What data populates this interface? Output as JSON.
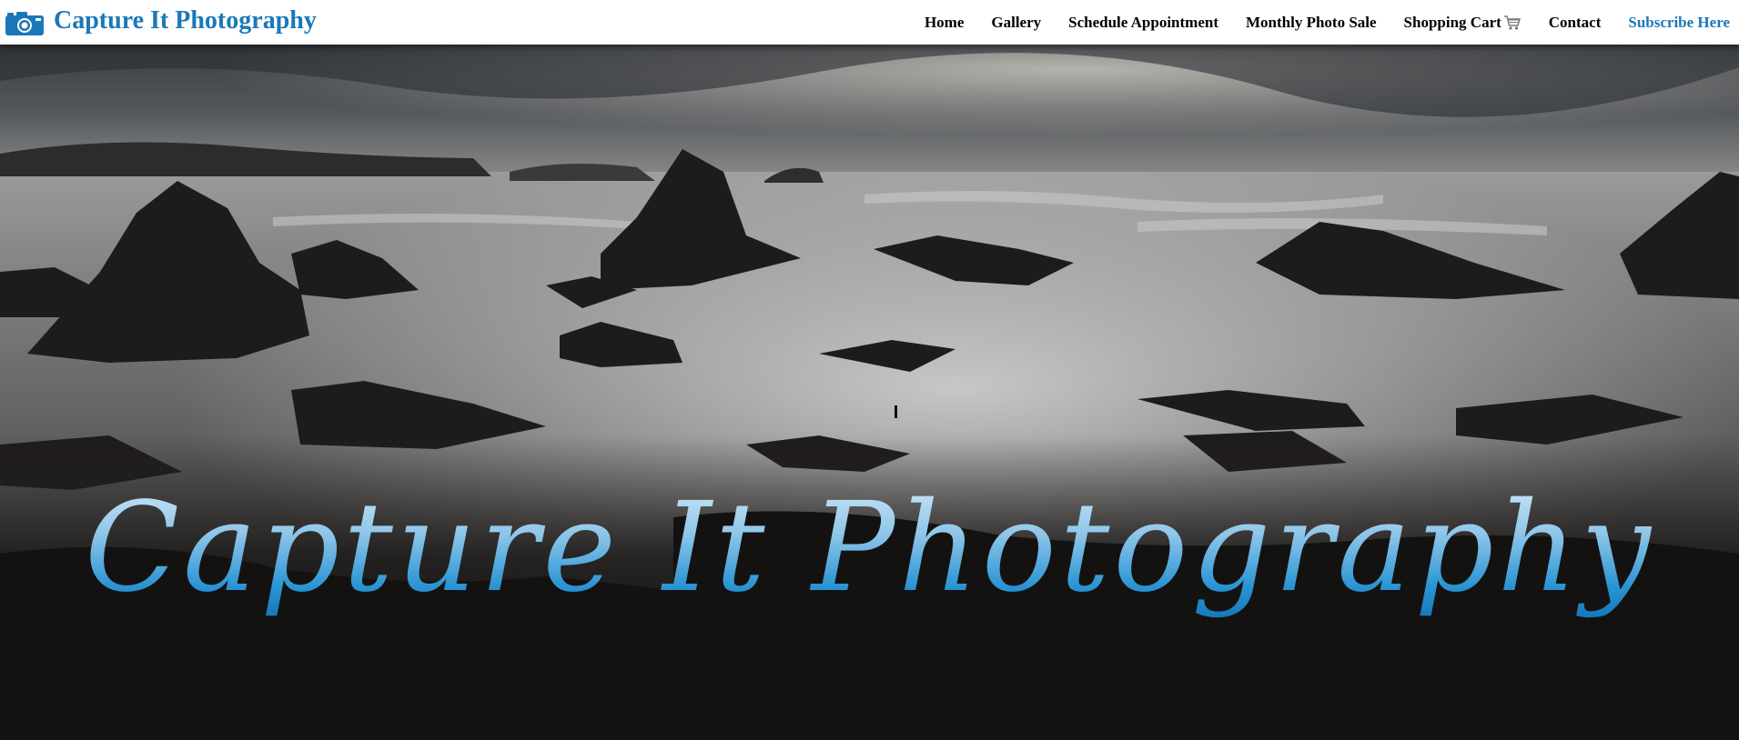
{
  "brand": {
    "name": "Capture It Photography",
    "icon": "camera-icon",
    "color": "#1b78b8"
  },
  "nav": {
    "items": [
      {
        "label": "Home"
      },
      {
        "label": "Gallery"
      },
      {
        "label": "Schedule Appointment"
      },
      {
        "label": "Monthly Photo Sale"
      },
      {
        "label": "Shopping Cart",
        "icon": "shopping-cart-icon"
      },
      {
        "label": "Contact"
      },
      {
        "label": "Subscribe Here",
        "accent": true
      }
    ]
  },
  "hero": {
    "title": "Capture It Photography",
    "description_image": "coastal-rocks-photo",
    "title_gradient": [
      "#d4ecfb",
      "#1174b7"
    ]
  }
}
